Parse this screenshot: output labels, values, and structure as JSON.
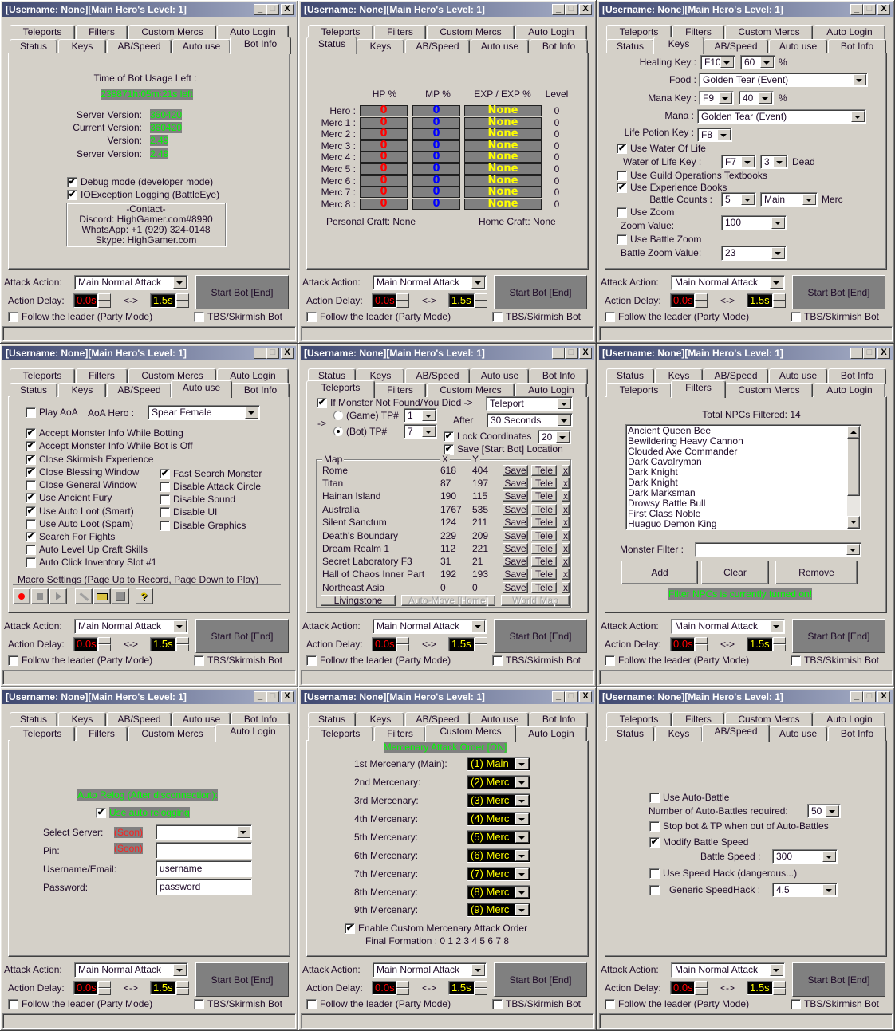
{
  "window_title": "[Username: None][Main Hero's Level: 1]",
  "title_buttons": {
    "minimize": "_",
    "maximize": "□",
    "close": "X"
  },
  "tabs": {
    "row_a": [
      "Teleports",
      "Filters",
      "Custom Mercs",
      "Auto Login"
    ],
    "row_b": [
      "Status",
      "Keys",
      "AB/Speed",
      "Auto use",
      "Bot Info"
    ]
  },
  "windows": [
    {
      "selected_tab": "Bot Info"
    },
    {
      "selected_tab": "Status"
    },
    {
      "selected_tab": "Keys"
    },
    {
      "selected_tab": "Auto use"
    },
    {
      "selected_tab": "Teleports"
    },
    {
      "selected_tab": "Filters"
    },
    {
      "selected_tab": "Auto Login"
    },
    {
      "selected_tab": "Custom Mercs"
    },
    {
      "selected_tab": "AB/Speed"
    }
  ],
  "common": {
    "attack_action_label": "Attack Action:",
    "attack_action": "Main Normal Attack",
    "start_button": "Start Bot [End]",
    "action_delay_label": "Action Delay:",
    "delay_min": "0.0s",
    "delay_separator": "<->",
    "delay_max": "1.5s",
    "follow_leader": {
      "label": "Follow the leader (Party Mode)",
      "checked": false
    },
    "tbs_skirmish": {
      "label": "TBS/Skirmish Bot",
      "checked": false
    }
  },
  "colors": {
    "highlight_text": "#00ff00",
    "highlight_bg": "#808080",
    "hp": "#ff0000",
    "mp": "#0000ff",
    "exp": "#ffff00",
    "delay_min": "#ff0000",
    "delay_max": "#ffff00"
  },
  "bot_info": {
    "time_label": "Time of Bot Usage Left :",
    "time_left": "239871h:05m:21s left",
    "versions": [
      {
        "label": "Server Version:",
        "value": "360420"
      },
      {
        "label": "Current Version:",
        "value": "360420"
      },
      {
        "label": "Version:",
        "value": "2.49"
      },
      {
        "label": "Server Version:",
        "value": "2.49"
      }
    ],
    "debug": {
      "label": "Debug mode (developer mode)",
      "checked": true
    },
    "ioexception": {
      "label": "IOException Logging (BattleEye)",
      "checked": true
    },
    "contact": [
      "-Contact-",
      "Discord: HighGamer.com#8990",
      "WhatsApp: +1 (929) 324-0148",
      "Skype: HighGamer.com"
    ]
  },
  "status": {
    "headers": [
      "HP %",
      "MP %",
      "EXP / EXP %",
      "Level"
    ],
    "rows": [
      {
        "name": "Hero   :",
        "hp": "0",
        "mp": "0",
        "exp": "None",
        "level": "0"
      },
      {
        "name": "Merc 1 :",
        "hp": "0",
        "mp": "0",
        "exp": "None",
        "level": "0"
      },
      {
        "name": "Merc 2 :",
        "hp": "0",
        "mp": "0",
        "exp": "None",
        "level": "0"
      },
      {
        "name": "Merc 3 :",
        "hp": "0",
        "mp": "0",
        "exp": "None",
        "level": "0"
      },
      {
        "name": "Merc 4 :",
        "hp": "0",
        "mp": "0",
        "exp": "None",
        "level": "0"
      },
      {
        "name": "Merc 5 :",
        "hp": "0",
        "mp": "0",
        "exp": "None",
        "level": "0"
      },
      {
        "name": "Merc 6 :",
        "hp": "0",
        "mp": "0",
        "exp": "None",
        "level": "0"
      },
      {
        "name": "Merc 7 :",
        "hp": "0",
        "mp": "0",
        "exp": "None",
        "level": "0"
      },
      {
        "name": "Merc 8 :",
        "hp": "0",
        "mp": "0",
        "exp": "None",
        "level": "0"
      }
    ],
    "personal_craft": "Personal Craft: None",
    "home_craft": "Home Craft: None"
  },
  "keys": {
    "healing_key_label": "Healing Key :",
    "healing_key": "F10",
    "healing_pct": "60",
    "pct": "%",
    "food_label": "Food :",
    "food": "Golden Tear (Event)",
    "mana_key_label": "Mana Key :",
    "mana_key": "F9",
    "mana_pct": "40",
    "mana_label": "Mana :",
    "mana": "Golden Tear (Event)",
    "life_potion_label": "Life Potion Key :",
    "life_potion": "F8",
    "water_of_life": {
      "label": "Use Water Of Life",
      "checked": true
    },
    "wol_key_label": "Water of Life Key :",
    "wol_key": "F7",
    "wol_count": "3",
    "dead": "Dead",
    "guild_textbooks": {
      "label": "Use Guild Operations Textbooks",
      "checked": false
    },
    "exp_books": {
      "label": "Use Experience Books",
      "checked": true
    },
    "battle_counts_label": "Battle Counts :",
    "battle_counts": "5",
    "battle_target": "Main",
    "merc": "Merc",
    "use_zoom": {
      "label": "Use Zoom",
      "checked": false
    },
    "zoom_label": "Zoom Value:",
    "zoom": "100",
    "battle_zoom": {
      "label": "Use Battle Zoom",
      "checked": false
    },
    "battle_zoom_label": "Battle Zoom Value:",
    "battle_zoom_value": "23"
  },
  "auto_use": {
    "play_aoa": {
      "label": "Play AoA",
      "checked": false
    },
    "aoa_hero_label": "AoA Hero :",
    "aoa_hero": "Spear Female",
    "left": [
      {
        "label": "Accept Monster Info While Botting",
        "checked": true
      },
      {
        "label": "Accept Monster Info While Bot is Off",
        "checked": true
      },
      {
        "label": "Close Skirmish Experience",
        "checked": true
      },
      {
        "label": "Close Blessing Window",
        "checked": true
      },
      {
        "label": "Close General Window",
        "checked": false
      },
      {
        "label": "Use Ancient Fury",
        "checked": true
      },
      {
        "label": "Use Auto Loot (Smart)",
        "checked": true
      },
      {
        "label": "Use Auto Loot (Spam)",
        "checked": false
      },
      {
        "label": "Search For Fights",
        "checked": true
      },
      {
        "label": "Auto Level Up Craft Skills",
        "checked": false
      },
      {
        "label": "Auto Click Inventory Slot #1",
        "checked": false
      }
    ],
    "right": [
      {
        "label": "Fast Search Monster",
        "checked": true
      },
      {
        "label": "Disable Attack Circle",
        "checked": false
      },
      {
        "label": "Disable Sound",
        "checked": false
      },
      {
        "label": "Disable UI",
        "checked": false
      },
      {
        "label": "Disable Graphics",
        "checked": false
      }
    ],
    "macro_label": "Macro Settings (Page Up to Record, Page Down to Play)",
    "help": "?"
  },
  "teleports": {
    "if_monster": {
      "label": "If Monster Not Found/You Died ->",
      "checked": true
    },
    "action": "Teleport",
    "arrow": "->",
    "game_tp": {
      "label": "(Game) TP#",
      "selected": false
    },
    "game_tp_value": "1",
    "bot_tp": {
      "label": "(Bot) TP#",
      "selected": true
    },
    "bot_tp_value": "7",
    "after_label": "After",
    "after": "30 Seconds",
    "lock": {
      "label": "Lock Coordinates",
      "checked": true
    },
    "lock_value": "20",
    "save_location": {
      "label": "Save [Start Bot] Location",
      "checked": true
    },
    "headers": {
      "map": "Map",
      "x": "X",
      "y": "Y"
    },
    "save_label": "Save",
    "tele_label": "Tele",
    "delete_label": "x",
    "maps": [
      {
        "name": "Rome",
        "x": "618",
        "y": "404"
      },
      {
        "name": "Titan",
        "x": "87",
        "y": "197"
      },
      {
        "name": "Hainan Island",
        "x": "190",
        "y": "115"
      },
      {
        "name": "Australia",
        "x": "1767",
        "y": "535"
      },
      {
        "name": "Silent Sanctum",
        "x": "124",
        "y": "211"
      },
      {
        "name": "Death's Boundary",
        "x": "229",
        "y": "209"
      },
      {
        "name": "Dream Realm 1",
        "x": "112",
        "y": "221"
      },
      {
        "name": "Secret Laboratory F3",
        "x": "31",
        "y": "21"
      },
      {
        "name": "Hall of Chaos Inner Part",
        "x": "192",
        "y": "193"
      },
      {
        "name": "Northeast Asia",
        "x": "0",
        "y": "0"
      }
    ],
    "livingstone": "Livingstone",
    "auto_move": "Auto-Move [Home]",
    "world_map": "World Map"
  },
  "filters": {
    "total": "Total NPCs Filtered: 14",
    "npcs": [
      "Ancient Queen Bee",
      "Bewildering Heavy Cannon",
      "Clouded Axe Commander",
      "Dark Cavalryman",
      "Dark Knight",
      "Dark Knight",
      "Dark Marksman",
      "Drowsy Battle Bull",
      "First Class Noble",
      "Huaguo Demon King"
    ],
    "monster_filter_label": "Monster Filter :",
    "monster_filter": "",
    "add": "Add",
    "clear": "Clear",
    "remove": "Remove",
    "status": "Filter NPCs is currently turned on!"
  },
  "auto_login": {
    "header": "Auto Relog (After disconnection):",
    "use_relog": {
      "label": "Use auto relogging",
      "checked": true
    },
    "server_label": "Select Server:",
    "soon": "(Soon)",
    "server": "",
    "pin_label": "Pin:",
    "pin": "",
    "username_label": "Username/Email:",
    "username": "username",
    "password_label": "Password:",
    "password": "password"
  },
  "custom_mercs": {
    "header": "Mercenary Attack Order [ON]",
    "rows": [
      {
        "label": "1st Mercenary (Main):",
        "value": "(1) Main"
      },
      {
        "label": "2nd Mercenary:",
        "value": "(2) Merc"
      },
      {
        "label": "3rd Mercenary:",
        "value": "(3) Merc"
      },
      {
        "label": "4th Mercenary:",
        "value": "(4) Merc"
      },
      {
        "label": "5th Mercenary:",
        "value": "(5) Merc"
      },
      {
        "label": "6th Mercenary:",
        "value": "(6) Merc"
      },
      {
        "label": "7th Mercenary:",
        "value": "(7) Merc"
      },
      {
        "label": "8th Mercenary:",
        "value": "(8) Merc"
      },
      {
        "label": "9th Mercenary:",
        "value": "(9) Merc"
      }
    ],
    "enable": {
      "label": "Enable Custom Mercenary Attack Order",
      "checked": true
    },
    "final": "Final Formation : 0 1 2 3 4 5 6 7 8"
  },
  "ab_speed": {
    "use_auto_battle": {
      "label": "Use Auto-Battle",
      "checked": false
    },
    "count_label": "Number of Auto-Battles required:",
    "count": "50",
    "stop_bot": {
      "label": "Stop bot & TP when out of Auto-Battles",
      "checked": false
    },
    "modify_speed": {
      "label": "Modify Battle Speed",
      "checked": true
    },
    "speed_label": "Battle Speed :",
    "speed": "300",
    "speed_hack": {
      "label": "Use Speed Hack (dangerous...)",
      "checked": false
    },
    "generic": {
      "label": "",
      "checked": false
    },
    "generic_label": "Generic SpeedHack :",
    "generic_value": "4.5"
  }
}
